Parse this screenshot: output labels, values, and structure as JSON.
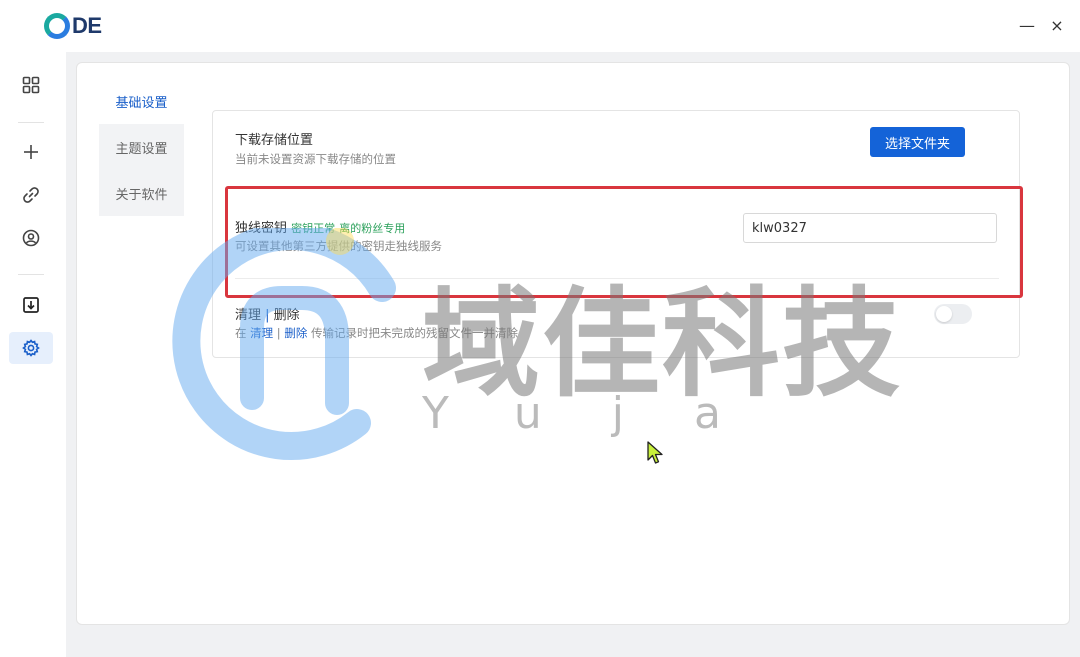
{
  "app": {
    "logo_text": "DE"
  },
  "window": {
    "minimize": "—",
    "close": "×"
  },
  "nav": {
    "icons": [
      "grid-icon",
      "plus-icon",
      "link-icon",
      "user-icon",
      "download-icon",
      "gear-icon"
    ],
    "active": "gear-icon"
  },
  "tabs": [
    {
      "label": "基础设置",
      "active": true
    },
    {
      "label": "主题设置",
      "active": false
    },
    {
      "label": "关于软件",
      "active": false
    }
  ],
  "settings": {
    "download": {
      "title": "下载存储位置",
      "desc": "当前未设置资源下载存储的位置",
      "button": "选择文件夹"
    },
    "key": {
      "title": "独线密钥",
      "status": "密钥正常",
      "tag": "离的粉丝专用",
      "desc": "可设置其他第三方提供的密钥走独线服务",
      "value": "klw0327"
    },
    "clean": {
      "title_prefix": "清理",
      "title_sep": " | ",
      "title_suffix": "删除",
      "desc_prefix": "在 ",
      "desc_link1": "清理",
      "desc_sep": " | ",
      "desc_link2": "删除",
      "desc_rest": " 传输记录时把未完成的残留文件一并清除"
    }
  },
  "watermark": {
    "text": "域佳科技",
    "sub": "Yuja"
  },
  "colors": {
    "primary": "#1463d8",
    "accent_text": "#1a5fc9",
    "status_green": "#2aa05a",
    "highlight_red": "#d9363e",
    "logo_blue": "#2b7de0",
    "logo_teal": "#1aa9a0"
  }
}
